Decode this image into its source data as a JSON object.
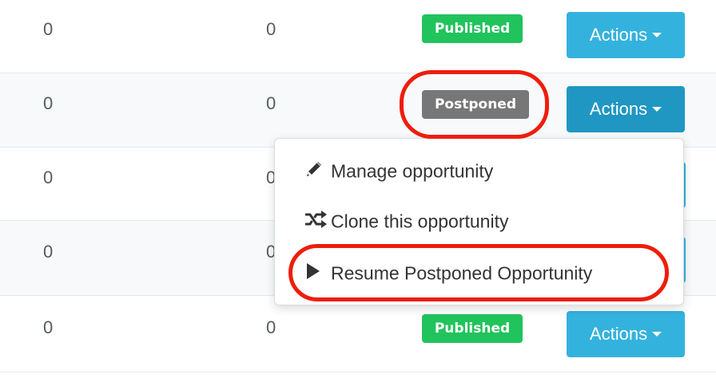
{
  "rows": [
    {
      "col1": "0",
      "col2": "0",
      "status": "Published",
      "action_label": "Actions"
    },
    {
      "col1": "0",
      "col2": "0",
      "status": "Postponed",
      "action_label": "Actions"
    },
    {
      "col1": "0",
      "col2": "0"
    },
    {
      "col1": "0",
      "col2": "0"
    },
    {
      "col1": "0",
      "col2": "0",
      "status": "Published",
      "action_label": "Actions"
    }
  ],
  "dropdown": {
    "items": [
      {
        "label": "Manage opportunity",
        "icon": "pencil-icon"
      },
      {
        "label": "Clone this opportunity",
        "icon": "shuffle-icon"
      },
      {
        "label": "Resume Postponed Opportunity",
        "icon": "play-icon"
      }
    ]
  },
  "colors": {
    "published": "#21c35c",
    "postponed": "#777777",
    "actions_button": "#34b2de",
    "highlight": "#ee1d0b"
  }
}
